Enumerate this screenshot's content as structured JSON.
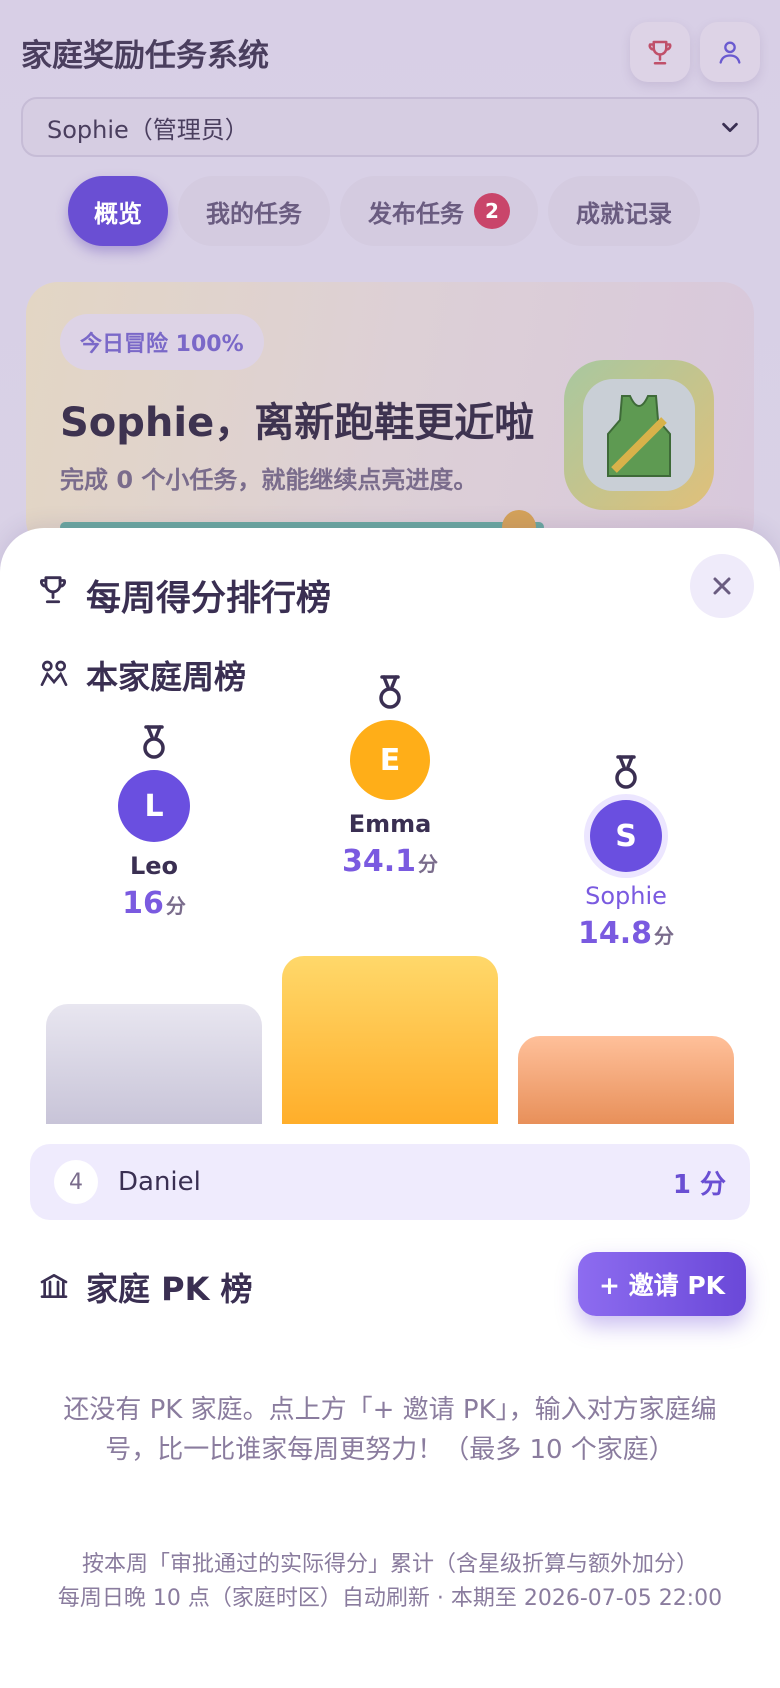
{
  "app": {
    "title": "家庭奖励任务系统"
  },
  "header": {
    "trophy_icon": "trophy-icon",
    "user_icon": "user-icon"
  },
  "user_select": {
    "value": "Sophie（管理员）"
  },
  "tabs": [
    {
      "label": "概览",
      "active": true
    },
    {
      "label": "我的任务",
      "active": false
    },
    {
      "label": "发布任务",
      "active": false,
      "badge": "2"
    },
    {
      "label": "成就记录",
      "active": false
    }
  ],
  "hero": {
    "pill": "今日冒险 100%",
    "title": "Sophie，离新跑鞋更近啦",
    "subtitle": "完成 0 个小任务，就能继续点亮进度。",
    "progress": 1.0
  },
  "leaderboard": {
    "title": "每周得分排行榜",
    "family_section": "本家庭周榜",
    "podium": [
      {
        "rank": 2,
        "initial": "L",
        "name": "Leo",
        "score": "16",
        "unit": "分",
        "avatar_color": "#6a4fe0"
      },
      {
        "rank": 1,
        "initial": "E",
        "name": "Emma",
        "score": "34.1",
        "unit": "分",
        "avatar_color": "#ffae18"
      },
      {
        "rank": 3,
        "initial": "S",
        "name": "Sophie",
        "score": "14.8",
        "unit": "分",
        "avatar_color": "#6a4fe0"
      }
    ],
    "others": [
      {
        "rank": "4",
        "name": "Daniel",
        "score": "1 分"
      }
    ],
    "pk_section": "家庭 PK 榜",
    "invite_label": "+ 邀请 PK",
    "pk_empty": "还没有 PK 家庭。点上方「+ 邀请 PK」，输入对方家庭编号，比一比谁家每周更努力！（最多 10 个家庭）",
    "footnote_line1": "按本周「审批通过的实际得分」累计（含星级折算与额外加分）",
    "footnote_line2": "每周日晚 10 点（家庭时区）自动刷新 · 本期至 2026-07-05 22:00"
  }
}
